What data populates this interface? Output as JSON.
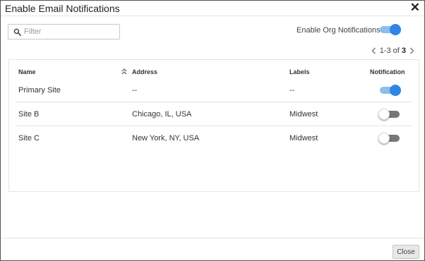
{
  "dialog": {
    "title": "Enable Email Notifications",
    "close_icon": "close-icon"
  },
  "filter": {
    "placeholder": "Filter",
    "value": "",
    "icon": "search-icon"
  },
  "org_notifications": {
    "label": "Enable Org Notifications",
    "enabled": true
  },
  "pagination": {
    "range": "1-3 of ",
    "total": "3",
    "prev_icon": "chevron-left-icon",
    "next_icon": "chevron-right-icon"
  },
  "table": {
    "headers": {
      "name": "Name",
      "address": "Address",
      "labels": "Labels",
      "notification": "Notification"
    },
    "sort_icon": "sort-ascending-icon",
    "rows": [
      {
        "name": "Primary Site",
        "address": "--",
        "labels": "--",
        "notification": true
      },
      {
        "name": "Site B",
        "address": "Chicago, IL, USA",
        "labels": "Midwest",
        "notification": false
      },
      {
        "name": "Site C",
        "address": "New York, NY, USA",
        "labels": "Midwest",
        "notification": false
      }
    ]
  },
  "footer": {
    "close_label": "Close"
  },
  "colors": {
    "toggle_on_knob": "#2f86e6",
    "toggle_on_track": "#8dbcef",
    "toggle_off_track": "#777777",
    "border": "#e4e4e4"
  }
}
